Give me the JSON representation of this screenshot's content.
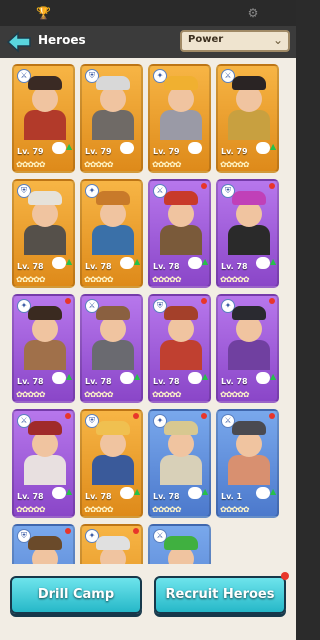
{
  "topbar": {
    "left_icon": "trophy-icon",
    "right_icon": "gear-icon"
  },
  "header": {
    "title": "Heroes",
    "sort_value": "Power"
  },
  "hero_cards": [
    {
      "level": "Lv. 79",
      "rarity": "orange",
      "new_dot": false,
      "upgrade": true,
      "hat": "#3a2a24",
      "body": "#b23a2a"
    },
    {
      "level": "Lv. 79",
      "rarity": "orange",
      "new_dot": false,
      "upgrade": false,
      "hat": "#d8d8d8",
      "body": "#6f6a66"
    },
    {
      "level": "Lv. 79",
      "rarity": "orange",
      "new_dot": false,
      "upgrade": false,
      "hat": "#f0b030",
      "body": "#9a9aa6"
    },
    {
      "level": "Lv. 79",
      "rarity": "orange",
      "new_dot": false,
      "upgrade": true,
      "hat": "#2a2424",
      "body": "#c8a040"
    },
    {
      "level": "Lv. 78",
      "rarity": "orange",
      "new_dot": false,
      "upgrade": true,
      "hat": "#e6e2da",
      "body": "#55504a"
    },
    {
      "level": "Lv. 78",
      "rarity": "orange",
      "new_dot": false,
      "upgrade": true,
      "hat": "#c87a2a",
      "body": "#3a70a8"
    },
    {
      "level": "Lv. 78",
      "rarity": "purple",
      "new_dot": true,
      "upgrade": true,
      "hat": "#c83a2a",
      "body": "#7a5a3a"
    },
    {
      "level": "Lv. 78",
      "rarity": "purple",
      "new_dot": true,
      "upgrade": true,
      "hat": "#c040b8",
      "body": "#2a2a2a"
    },
    {
      "level": "Lv. 78",
      "rarity": "purple",
      "new_dot": true,
      "upgrade": true,
      "hat": "#3a2a20",
      "body": "#a0704a"
    },
    {
      "level": "Lv. 78",
      "rarity": "purple",
      "new_dot": false,
      "upgrade": true,
      "hat": "#8a6040",
      "body": "#6a6a70"
    },
    {
      "level": "Lv. 78",
      "rarity": "purple",
      "new_dot": true,
      "upgrade": true,
      "hat": "#a4402a",
      "body": "#c04030"
    },
    {
      "level": "Lv. 78",
      "rarity": "purple",
      "new_dot": true,
      "upgrade": true,
      "hat": "#2a2a30",
      "body": "#7040a0"
    },
    {
      "level": "Lv. 78",
      "rarity": "purple",
      "new_dot": true,
      "upgrade": true,
      "hat": "#a02a2a",
      "body": "#e8e0e0"
    },
    {
      "level": "Lv. 78",
      "rarity": "orange",
      "new_dot": true,
      "upgrade": true,
      "hat": "#f0c050",
      "body": "#3a5a9a"
    },
    {
      "level": "Lv. 78",
      "rarity": "blue",
      "new_dot": true,
      "upgrade": true,
      "hat": "#d8c890",
      "body": "#d8d0b8"
    },
    {
      "level": "Lv. 1",
      "rarity": "blue",
      "new_dot": true,
      "upgrade": true,
      "hat": "#4a4a50",
      "body": "#d89070"
    },
    {
      "level": "",
      "rarity": "blue",
      "new_dot": true,
      "upgrade": false,
      "hat": "#6a4a2a",
      "body": "#c08a5a"
    },
    {
      "level": "",
      "rarity": "orange",
      "new_dot": true,
      "upgrade": false,
      "hat": "#e0e0e0",
      "body": "#c88a5a"
    },
    {
      "level": "",
      "rarity": "blue",
      "new_dot": false,
      "upgrade": false,
      "hat": "#40b040",
      "body": "#c8a070"
    }
  ],
  "buttons": {
    "drill_camp": "Drill Camp",
    "recruit_heroes": "Recruit Heroes"
  },
  "colors": {
    "header_bg": "#3b3b3b",
    "button_teal": "#26b8c8",
    "new_dot": "#e8362a",
    "upgrade_arrow": "#26c04a"
  }
}
